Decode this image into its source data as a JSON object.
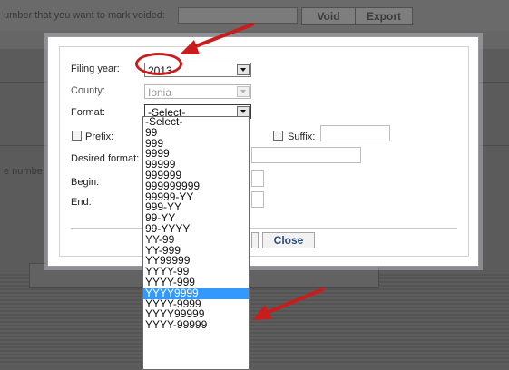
{
  "background": {
    "top_label": "umber that you want to mark voided:",
    "void_button": "Void",
    "export_button": "Export",
    "side_label": "e numbe"
  },
  "dialog": {
    "filing_year": {
      "label": "Filing year:",
      "value": "2013"
    },
    "county": {
      "label": "County:",
      "value": "Ionia"
    },
    "format": {
      "label": "Format:",
      "value": "-Select-"
    },
    "prefix": {
      "label": "Prefix:"
    },
    "suffix": {
      "label": "Suffix:"
    },
    "desired_format": {
      "label": "Desired format:"
    },
    "begin": {
      "label": "Begin:"
    },
    "end": {
      "label": "End:"
    },
    "close_button": "Close"
  },
  "format_options": [
    "-Select-",
    "99",
    "999",
    "9999",
    "99999",
    "999999",
    "999999999",
    "99999-YY",
    "999-YY",
    "99-YY",
    "99-YYYY",
    "YY-99",
    "YY-999",
    "YY99999",
    "YYYY-99",
    "YYYY-999",
    "YYYY9999",
    "YYYY-9999",
    "YYYY99999",
    "YYYY-99999"
  ],
  "selected_option_index": 16,
  "colors": {
    "annotation": "#c81d1d",
    "selection": "#3399ff",
    "button_text": "#2a4c7a"
  }
}
